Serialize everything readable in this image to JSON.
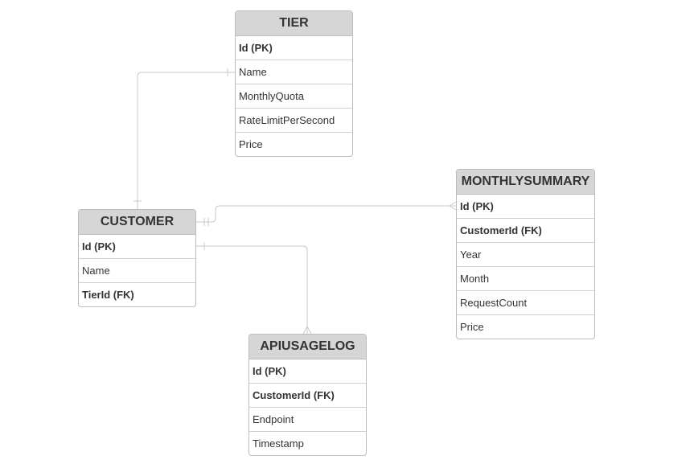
{
  "entities": {
    "tier": {
      "title": "TIER",
      "attributes": [
        {
          "label": "Id (PK)",
          "key": true
        },
        {
          "label": "Name",
          "key": false
        },
        {
          "label": "MonthlyQuota",
          "key": false
        },
        {
          "label": "RateLimitPerSecond",
          "key": false
        },
        {
          "label": "Price",
          "key": false
        }
      ]
    },
    "customer": {
      "title": "CUSTOMER",
      "attributes": [
        {
          "label": "Id (PK)",
          "key": true
        },
        {
          "label": "Name",
          "key": false
        },
        {
          "label": "TierId (FK)",
          "key": true
        }
      ]
    },
    "monthlysummary": {
      "title": "MONTHLYSUMMARY",
      "attributes": [
        {
          "label": "Id (PK)",
          "key": true
        },
        {
          "label": "CustomerId (FK)",
          "key": true
        },
        {
          "label": "Year",
          "key": false
        },
        {
          "label": "Month",
          "key": false
        },
        {
          "label": "RequestCount",
          "key": false
        },
        {
          "label": "Price",
          "key": false
        }
      ]
    },
    "apiusagelog": {
      "title": "APIUSAGELOG",
      "attributes": [
        {
          "label": "Id (PK)",
          "key": true
        },
        {
          "label": "CustomerId (FK)",
          "key": true
        },
        {
          "label": "Endpoint",
          "key": false
        },
        {
          "label": "Timestamp",
          "key": false
        }
      ]
    }
  },
  "colors": {
    "header_bg": "#d6d6d6",
    "border": "#bdbdbd",
    "connector": "#c8c8c8",
    "text": "#333333"
  }
}
